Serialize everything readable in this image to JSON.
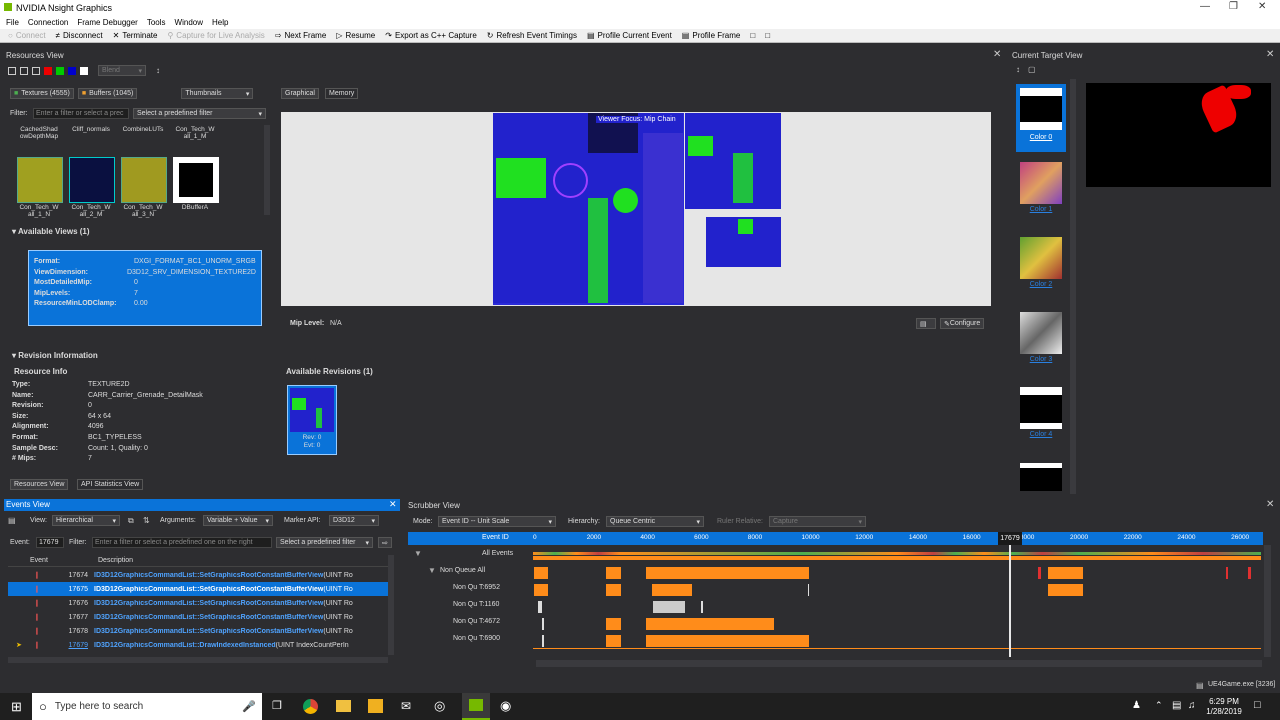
{
  "window": {
    "title": "NVIDIA Nsight Graphics"
  },
  "menu": [
    "File",
    "Connection",
    "Frame Debugger",
    "Tools",
    "Window",
    "Help"
  ],
  "toolbar": {
    "connect": "Connect",
    "disconnect": "Disconnect",
    "terminate": "Terminate",
    "capture_live": "Capture for Live Analysis",
    "next_frame": "Next Frame",
    "resume": "Resume",
    "export_cpp": "Export as C++ Capture",
    "refresh_timings": "Refresh Event Timings",
    "profile_event": "Profile Current Event",
    "profile_frame": "Profile Frame"
  },
  "resources": {
    "title": "Resources View",
    "blend": "Blend",
    "textures_tab": "Textures (4555)",
    "buffers_tab": "Buffers (1045)",
    "view_mode": "Thumbnails",
    "filter_label": "Filter:",
    "filter_placeholder": "Enter a filter or select a prec",
    "predefined": "Select a predefined filter",
    "top_items": [
      "CachedShad owDepthMap",
      "Cliff_normals",
      "CombineLUTs",
      "Con_Tech_W all_1_M"
    ],
    "thumbs": [
      "Con_Tech_W all_1_N",
      "Con_Tech_W all_2_M",
      "Con_Tech_W all_3_N",
      "DBufferA"
    ],
    "available_views": "Available Views (1)",
    "view_props": [
      {
        "k": "Format:",
        "v": "DXGI_FORMAT_BC1_UNORM_SRGB"
      },
      {
        "k": "ViewDimension:",
        "v": "D3D12_SRV_DIMENSION_TEXTURE2D"
      },
      {
        "k": "MostDetailedMip:",
        "v": "0"
      },
      {
        "k": "MipLevels:",
        "v": "7"
      },
      {
        "k": "ResourceMinLODClamp:",
        "v": "0.00"
      }
    ],
    "graphical_tab": "Graphical",
    "memory_tab": "Memory",
    "viewer_focus": "Viewer Focus: Mip Chain",
    "mip_level_label": "Mip Level:",
    "mip_level_value": "N/A",
    "configure": "Configure",
    "revision_info": "Revision Information",
    "resource_info": "Resource Info",
    "info": [
      {
        "k": "Type:",
        "v": "TEXTURE2D"
      },
      {
        "k": "Name:",
        "v": "CARR_Carrier_Grenade_DetailMask"
      },
      {
        "k": "Revision:",
        "v": "0"
      },
      {
        "k": "Size:",
        "v": "64 x 64"
      },
      {
        "k": "Alignment:",
        "v": "4096"
      },
      {
        "k": "Format:",
        "v": "BC1_TYPELESS"
      },
      {
        "k": "Sample Desc:",
        "v": "Count: 1, Quality: 0"
      },
      {
        "k": "# Mips:",
        "v": "7"
      }
    ],
    "available_revisions": "Available Revisions (1)",
    "rev_line1": "Rev: 0",
    "rev_line2": "Evt: 0",
    "bottom_tab1": "Resources View",
    "bottom_tab2": "API Statistics View"
  },
  "current_target": {
    "title": "Current Target View",
    "colors": [
      "Color 0",
      "Color 1",
      "Color 2",
      "Color 3",
      "Color 4"
    ]
  },
  "events": {
    "title": "Events View",
    "view_label": "View:",
    "view_value": "Hierarchical",
    "args_label": "Arguments:",
    "args_value": "Variable + Value",
    "marker_label": "Marker API:",
    "marker_value": "D3D12",
    "event_label": "Event:",
    "event_value": "17679",
    "filter_label": "Filter:",
    "filter_placeholder": "Enter a filter or select a predefined one on the right",
    "predefined": "Select a predefined filter",
    "col_event": "Event",
    "col_desc": "Description",
    "rows": [
      {
        "num": "17674",
        "desc": "ID3D12GraphicsCommandList::SetGraphicsRootConstantBufferView",
        "args": "(UINT Ro"
      },
      {
        "num": "17675",
        "desc": "ID3D12GraphicsCommandList::SetGraphicsRootConstantBufferView",
        "args": "(UINT Ro"
      },
      {
        "num": "17676",
        "desc": "ID3D12GraphicsCommandList::SetGraphicsRootConstantBufferView",
        "args": "(UINT Ro"
      },
      {
        "num": "17677",
        "desc": "ID3D12GraphicsCommandList::SetGraphicsRootConstantBufferView",
        "args": "(UINT Ro"
      },
      {
        "num": "17678",
        "desc": "ID3D12GraphicsCommandList::SetGraphicsRootConstantBufferView",
        "args": "(UINT Ro"
      },
      {
        "num": "17679",
        "desc": "ID3D12GraphicsCommandList::DrawIndexedInstanced",
        "args": "(UINT IndexCountPerIn"
      }
    ]
  },
  "scrubber": {
    "title": "Scrubber View",
    "mode_label": "Mode:",
    "mode_value": "Event ID -- Unit Scale",
    "hierarchy_label": "Hierarchy:",
    "hierarchy_value": "Queue Centric",
    "ruler_label": "Ruler Relative:",
    "ruler_value": "Capture",
    "col_event_id": "Event ID",
    "ticks": [
      "0",
      "2000",
      "4000",
      "6000",
      "8000",
      "10000",
      "12000",
      "14000",
      "16000",
      "18000",
      "20000",
      "22000",
      "24000",
      "26000"
    ],
    "cursor_value": "17679",
    "rows": [
      "All Events",
      "Non Queue  All",
      "Non Qu  T:6952",
      "Non Qu  T:1160",
      "Non Qu  T:4672",
      "Non Qu  T:6900"
    ]
  },
  "status": {
    "process": "UE4Game.exe [3236]"
  },
  "taskbar": {
    "search_placeholder": "Type here to search",
    "time": "6:29 PM",
    "date": "1/28/2019"
  },
  "colors": {
    "accent": "#0a73d9",
    "orange": "#ff8c1a",
    "panel_bg": "#2d2d30"
  }
}
